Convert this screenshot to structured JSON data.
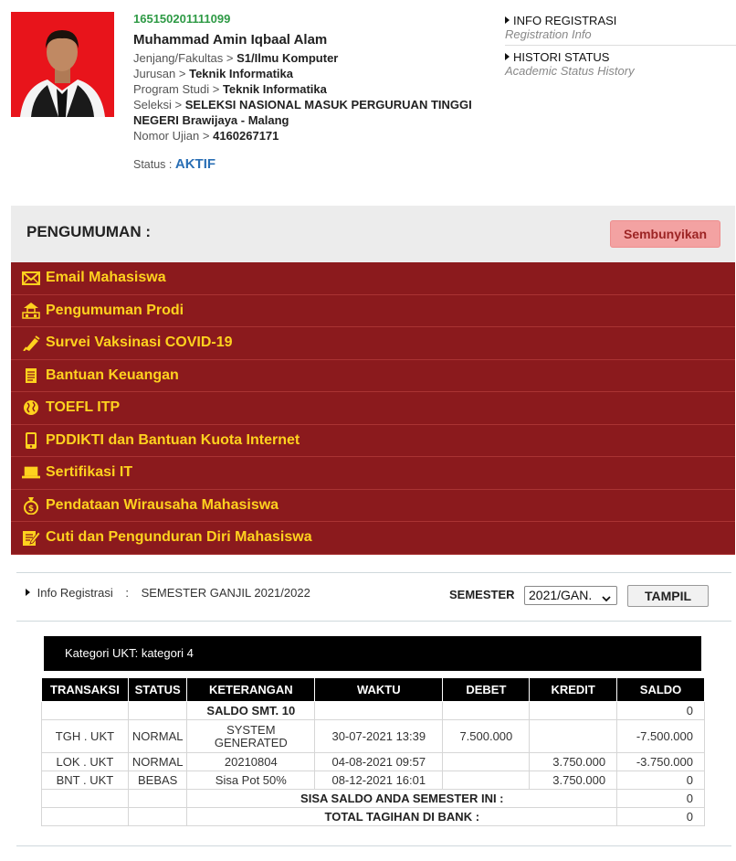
{
  "profile": {
    "nim": "165150201111099",
    "name": "Muhammad Amin Iqbaal Alam",
    "rows": [
      {
        "label": "Jenjang/Fakultas",
        "value": "S1/Ilmu Komputer"
      },
      {
        "label": "Jurusan",
        "value": "Teknik Informatika"
      },
      {
        "label": "Program Studi",
        "value": "Teknik Informatika"
      },
      {
        "label": "Seleksi",
        "value": "SELEKSI NASIONAL MASUK PERGURUAN TINGGI NEGERI Brawijaya - Malang"
      },
      {
        "label": "Nomor Ujian",
        "value": "4160267171"
      }
    ],
    "status_label": "Status :",
    "status_value": "AKTIF"
  },
  "side_links": [
    {
      "title": "INFO REGISTRASI",
      "subtitle": "Registration Info"
    },
    {
      "title": "HISTORI STATUS",
      "subtitle": "Academic Status History"
    }
  ],
  "announcement": {
    "title": "PENGUMUMAN :",
    "hide_label": "Sembunyikan",
    "items": [
      {
        "label": "Email Mahasiswa",
        "icon": "envelope-icon"
      },
      {
        "label": "Pengumuman Prodi",
        "icon": "building-icon"
      },
      {
        "label": "Survei Vaksinasi COVID-19",
        "icon": "syringe-icon"
      },
      {
        "label": "Bantuan Keuangan",
        "icon": "scroll-icon"
      },
      {
        "label": "TOEFL ITP",
        "icon": "globe-icon"
      },
      {
        "label": "PDDIKTI dan Bantuan Kuota Internet",
        "icon": "phone-icon"
      },
      {
        "label": "Sertifikasi IT",
        "icon": "laptop-icon"
      },
      {
        "label": "Pendataan Wirausaha Mahasiswa",
        "icon": "money-bag-icon"
      },
      {
        "label": "Cuti dan Pengunduran Diri Mahasiswa",
        "icon": "edit-document-icon"
      }
    ]
  },
  "registration": {
    "label": "Info Registrasi",
    "colon": ":",
    "value": "SEMESTER GANJIL 2021/2022",
    "semester_label": "SEMESTER",
    "semester_selected": "2021/GAN.",
    "show_button": "TAMPIL",
    "ukt": "Kategori UKT: kategori 4"
  },
  "table": {
    "headers": [
      "TRANSAKSI",
      "STATUS",
      "KETERANGAN",
      "WAKTU",
      "DEBET",
      "KREDIT",
      "SALDO"
    ],
    "saldo_row": {
      "label": "SALDO SMT. 10",
      "saldo": "0"
    },
    "rows": [
      {
        "transaksi": "TGH . UKT",
        "status": "NORMAL",
        "keterangan": "SYSTEM GENERATED",
        "waktu": "30-07-2021 13:39",
        "debet": "7.500.000",
        "kredit": "",
        "saldo": "-7.500.000"
      },
      {
        "transaksi": "LOK . UKT",
        "status": "NORMAL",
        "keterangan": "20210804",
        "waktu": "04-08-2021 09:57",
        "debet": "",
        "kredit": "3.750.000",
        "saldo": "-3.750.000"
      },
      {
        "transaksi": "BNT . UKT",
        "status": "BEBAS",
        "keterangan": "Sisa Pot 50%",
        "waktu": "08-12-2021 16:01",
        "debet": "",
        "kredit": "3.750.000",
        "saldo": "0"
      }
    ],
    "sisa_label": "SISA SALDO ANDA SEMESTER INI :",
    "sisa_value": "0",
    "total_label": "TOTAL TAGIHAN DI BANK :",
    "total_value": "0"
  }
}
